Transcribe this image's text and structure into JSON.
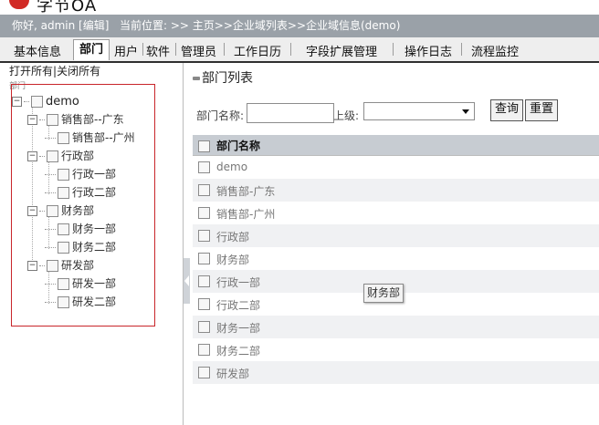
{
  "header": {
    "logo_text": "字节OA",
    "greeting": "你好, admin [编辑]",
    "location": "当前位置: >> 主页>>企业域列表>>企业域信息(demo)"
  },
  "menu": [
    {
      "label": "基本信息"
    },
    {
      "label": "部门",
      "active": true
    },
    {
      "label": "用户"
    },
    {
      "label": "软件"
    },
    {
      "label": "管理员"
    },
    {
      "label": "工作日历"
    },
    {
      "label": "字段扩展管理"
    },
    {
      "label": "操作日志"
    },
    {
      "label": "流程监控"
    }
  ],
  "tree_panel": {
    "expand_all": "打开所有",
    "separator": "|",
    "collapse_all": "关闭所有",
    "caption": "部门",
    "nodes": [
      {
        "label": "demo"
      },
      {
        "label": "销售部--广东"
      },
      {
        "label": "销售部--广州"
      },
      {
        "label": "行政部"
      },
      {
        "label": "行政一部"
      },
      {
        "label": "行政二部"
      },
      {
        "label": "财务部"
      },
      {
        "label": "财务一部"
      },
      {
        "label": "财务二部"
      },
      {
        "label": "研发部"
      },
      {
        "label": "研发一部"
      },
      {
        "label": "研发二部"
      }
    ]
  },
  "list_panel": {
    "title": "部门列表",
    "search": {
      "name_label": "部门名称:",
      "name_value": "",
      "parent_label": "上级:",
      "parent_value": "",
      "query_button": "查询",
      "reset_button": "重置"
    },
    "column_header": "部门名称",
    "rows": [
      "demo",
      "销售部-广东",
      "销售部-广州",
      "行政部",
      "财务部",
      "行政一部",
      "行政二部",
      "财务一部",
      "财务二部",
      "研发部"
    ]
  },
  "tooltip": "财务部",
  "colors": {
    "info_bar": "#9aa1a8",
    "tree_border": "#c8252a",
    "grid_header": "#c7ccd2",
    "logo": "#d12a25"
  }
}
